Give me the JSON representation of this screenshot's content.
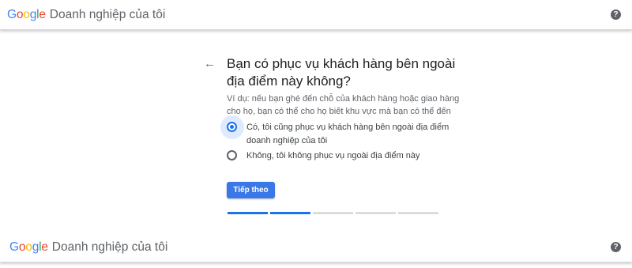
{
  "header": {
    "logo_letters": [
      {
        "char": "G",
        "color": "#4285F4"
      },
      {
        "char": "o",
        "color": "#EA4335"
      },
      {
        "char": "o",
        "color": "#FBBC05"
      },
      {
        "char": "g",
        "color": "#4285F4"
      },
      {
        "char": "l",
        "color": "#34A853"
      },
      {
        "char": "e",
        "color": "#EA4335"
      }
    ],
    "product_name": "Doanh nghiệp của tôi",
    "help_icon": "?"
  },
  "main": {
    "back_icon": "←",
    "title": "Bạn có phục vụ khách hàng bên ngoài địa điểm này không?",
    "hint": "Ví dụ: nếu bạn ghé đến chỗ của khách hàng hoặc giao hàng cho họ, bạn có thể cho họ biết khu vực mà bạn có thể đến",
    "options": [
      {
        "label": "Có, tôi cũng phục vụ khách hàng bên ngoài địa điểm doanh nghiệp của tôi",
        "selected": true
      },
      {
        "label": "Không, tôi không phục vụ ngoài địa điểm này",
        "selected": false
      }
    ],
    "next_label": "Tiếp theo",
    "progress": {
      "total_steps": 5,
      "completed_steps": 2
    }
  },
  "colors": {
    "accent": "#1a73e8",
    "button": "#3b78e7"
  }
}
